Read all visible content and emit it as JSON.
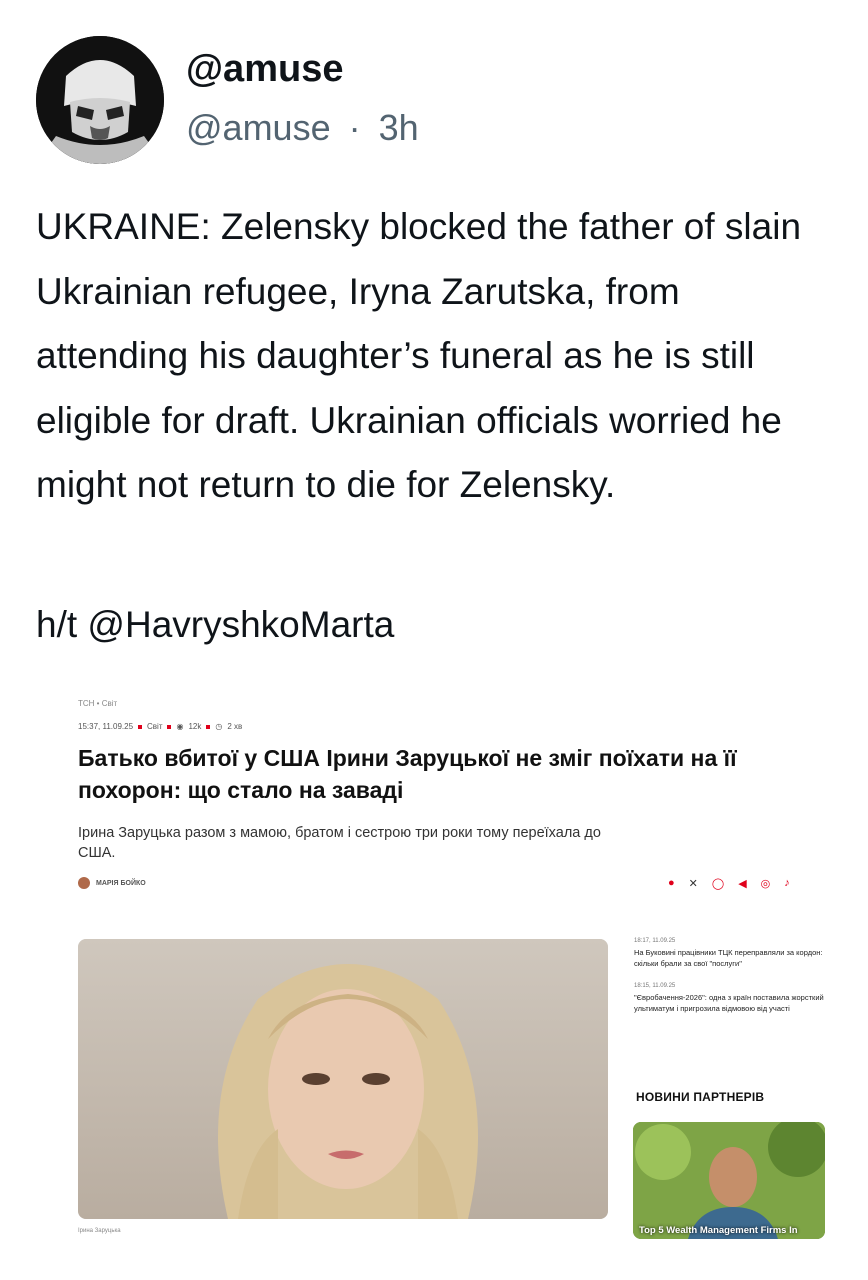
{
  "tweet": {
    "display_name": "@amuse",
    "handle": "@amuse",
    "separator": "·",
    "time": "3h",
    "text": "UKRAINE: Zelensky blocked the father of slain Ukrainian refugee, Iryna Zarutska, from attending his daughter’s funeral as he is still eligible for draft. Ukrainian officials worried he might not return to die for Zelensky.",
    "hat_tip": "h/t @HavryshkoMarta"
  },
  "embed": {
    "breadcrumb": "ТСН • Світ",
    "meta": {
      "date": "15:37, 11.09.25",
      "section": "Світ",
      "views": "12k",
      "read_time": "2 хв"
    },
    "title": "Батько вбитої у США Ірини Заруцької не зміг поїхати на її похорон: що стало на заваді",
    "lead": "Ірина Заруцька разом з мамою, братом і сестрою три роки тому переїхала до США.",
    "author": "МАРІЯ БОЙКО",
    "share_icons": [
      "facebook-icon",
      "x-icon",
      "whatsapp-icon",
      "telegram-icon",
      "viber-icon",
      "tiktok-icon"
    ],
    "photo_caption": "Ірина Заруцька",
    "sidebar_news": [
      {
        "time": "18:17, 11.09.25",
        "text": "На Буковині працівники ТЦК переправляли за кордон: скільки брали за свої \"послуги\""
      },
      {
        "time": "18:15, 11.09.25",
        "text": "\"Євробачення-2026\": одна з країн поставила жорсткий ультиматум і пригрозила відмовою від участі"
      }
    ],
    "partners_heading": "НОВИНИ ПАРТНЕРІВ",
    "ad_text": "Top 5 Wealth Management Firms In"
  }
}
